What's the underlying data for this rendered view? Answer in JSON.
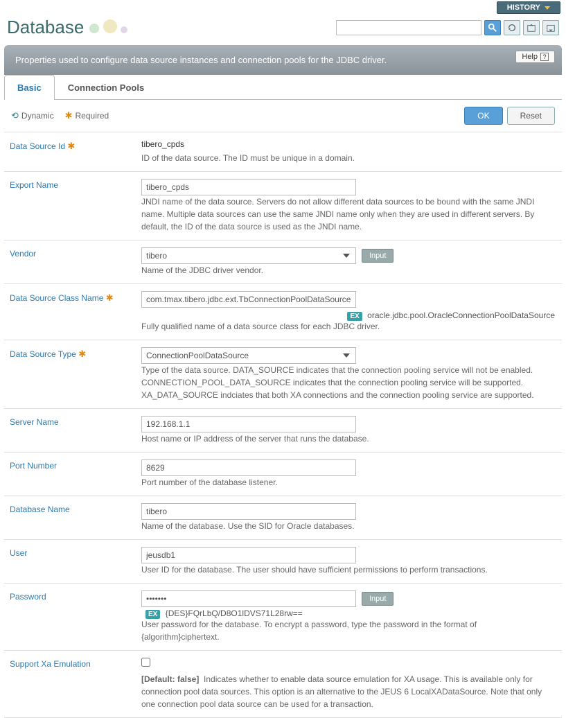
{
  "header": {
    "title": "Database",
    "history_label": "HISTORY",
    "help_label": "Help"
  },
  "description": "Properties used to configure data source instances and connection pools for the JDBC driver.",
  "tabs": [
    {
      "label": "Basic",
      "active": true
    },
    {
      "label": "Connection Pools",
      "active": false
    }
  ],
  "legend": {
    "dynamic": "Dynamic",
    "required": "Required"
  },
  "buttons": {
    "ok": "OK",
    "reset": "Reset",
    "input": "Input"
  },
  "fields": {
    "data_source_id": {
      "label": "Data Source Id",
      "required": true,
      "value": "tibero_cpds",
      "help": "ID of the data source. The ID must be unique in a domain."
    },
    "export_name": {
      "label": "Export Name",
      "value": "tibero_cpds",
      "help": "JNDI name of the data source. Servers do not allow different data sources to be bound with the same JNDI name. Multiple data sources can use the same JNDI name only when they are used in different servers. By default, the ID of the data source is used as the JNDI name."
    },
    "vendor": {
      "label": "Vendor",
      "value": "tibero",
      "help": "Name of the JDBC driver vendor."
    },
    "ds_class_name": {
      "label": "Data Source Class Name",
      "required": true,
      "value": "com.tmax.tibero.jdbc.ext.TbConnectionPoolDataSource",
      "example_label": "EX",
      "example": "oracle.jdbc.pool.OracleConnectionPoolDataSource",
      "help": "Fully qualified name of a data source class for each JDBC driver."
    },
    "ds_type": {
      "label": "Data Source Type",
      "required": true,
      "value": "ConnectionPoolDataSource",
      "help": "Type of the data source. DATA_SOURCE indicates that the connection pooling service will not be enabled. CONNECTION_POOL_DATA_SOURCE indicates that the connection pooling service will be supported. XA_DATA_SOURCE indciates that both XA connections and the connection pooling service are supported."
    },
    "server_name": {
      "label": "Server Name",
      "value": "192.168.1.1",
      "help": "Host name or IP address of the server that runs the database."
    },
    "port_number": {
      "label": "Port Number",
      "value": "8629",
      "help": "Port number of the database listener."
    },
    "database_name": {
      "label": "Database Name",
      "value": "tibero",
      "help": "Name of the database. Use the SID for Oracle databases."
    },
    "user": {
      "label": "User",
      "value": "jeusdb1",
      "help": "User ID for the database. The user should have sufficient permissions to perform transactions."
    },
    "password": {
      "label": "Password",
      "value": "•••••••",
      "example_label": "EX",
      "example": "{DES}FQrLbQ/D8O1lDVS71L28rw==",
      "help": "User password for the database. To encrypt a password, type the password in the format of {algorithm}ciphertext."
    },
    "support_xa": {
      "label": "Support Xa Emulation",
      "default_label": "[Default: false]",
      "help": "Indicates whether to enable data source emulation for XA usage. This is available only for connection pool data sources. This option is an alternative to the JEUS 6 LocalXADataSource. Note that only one connection pool data source can be used for a transaction."
    }
  }
}
